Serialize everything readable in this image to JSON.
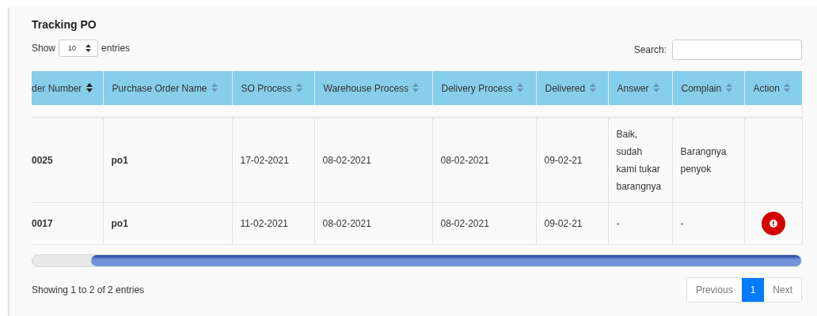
{
  "title": "Tracking PO",
  "length_menu": {
    "label_before": "Show",
    "value": "10",
    "label_after": "entries"
  },
  "search": {
    "label": "Search:"
  },
  "table": {
    "columns": [
      {
        "label": "der Number",
        "sorted": true
      },
      {
        "label": "Purchase Order Name",
        "sorted": false
      },
      {
        "label": "SO Process",
        "sorted": false
      },
      {
        "label": "Warehouse Process",
        "sorted": false
      },
      {
        "label": "Delivery Process",
        "sorted": false
      },
      {
        "label": "Delivered",
        "sorted": false
      },
      {
        "label": "Answer",
        "sorted": false
      },
      {
        "label": "Complain",
        "sorted": false
      },
      {
        "label": "Action",
        "sorted": false
      }
    ],
    "rows": [
      {
        "cells": [
          "0025",
          "po1",
          "17-02-2021",
          "08-02-2021",
          "08-02-2021",
          "09-02-21",
          "Baik, sudah kami tukar barangnya",
          "Barangnya penyok"
        ],
        "alert": false
      },
      {
        "cells": [
          "0017",
          "po1",
          "11-02-2021",
          "08-02-2021",
          "08-02-2021",
          "09-02-21",
          "-",
          "-"
        ],
        "alert": true
      }
    ]
  },
  "info": "Showing 1 to 2 of 2 entries",
  "pagination": [
    {
      "label": "Previous",
      "selected": false
    },
    {
      "label": "1",
      "selected": true
    },
    {
      "label": "Next",
      "selected": false
    }
  ]
}
